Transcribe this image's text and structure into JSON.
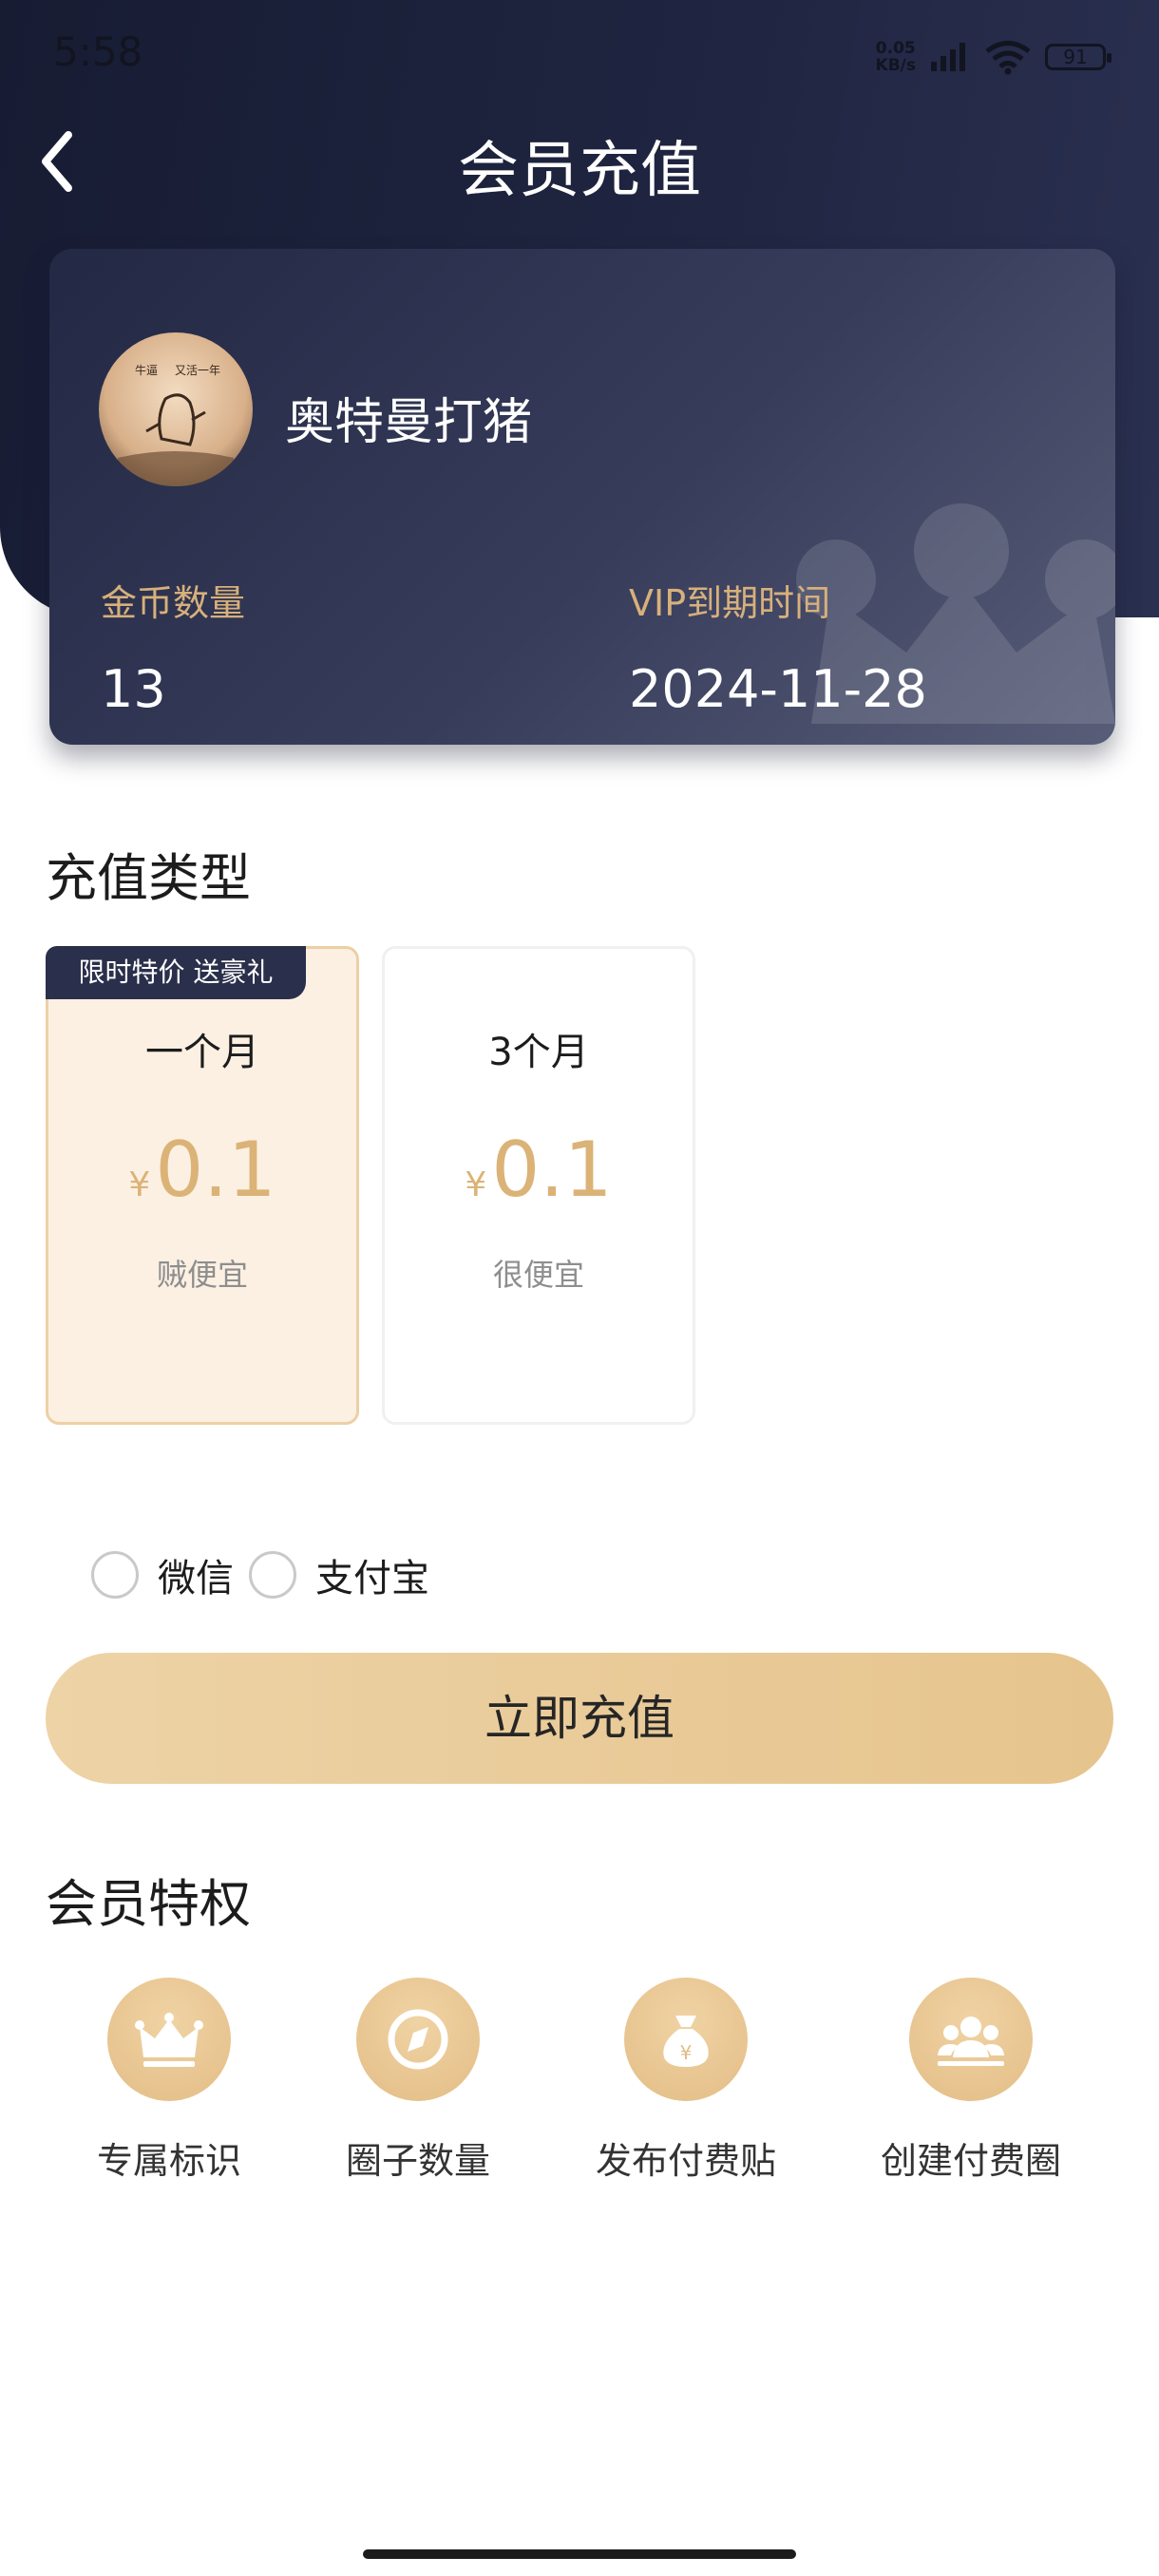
{
  "status_bar": {
    "time": "5:58",
    "net_speed_value": "0.05",
    "net_speed_unit": "KB/s",
    "battery": "91"
  },
  "header": {
    "title": "会员充值"
  },
  "member_card": {
    "username": "奥特曼打猪",
    "coins_label": "金币数量",
    "coins_value": "13",
    "vip_label": "VIP到期时间",
    "vip_value": "2024-11-28",
    "avatar_text_1": "牛逼",
    "avatar_text_2": "又活一年"
  },
  "recharge_type": {
    "title": "充值类型",
    "plans": [
      {
        "tag": "限时特价 送豪礼",
        "name": "一个月",
        "currency": "¥",
        "price": "0.1",
        "desc": "贼便宜",
        "selected": true
      },
      {
        "name": "3个月",
        "currency": "¥",
        "price": "0.1",
        "desc": "很便宜",
        "selected": false
      }
    ]
  },
  "payment": {
    "options": [
      "微信",
      "支付宝"
    ]
  },
  "recharge_button": "立即充值",
  "privileges": {
    "title": "会员特权",
    "items": [
      {
        "label": "专属标识",
        "icon": "crown-icon"
      },
      {
        "label": "圈子数量",
        "icon": "compass-icon"
      },
      {
        "label": "发布付费贴",
        "icon": "money-bag-icon"
      },
      {
        "label": "创建付费圈",
        "icon": "group-icon"
      }
    ]
  },
  "colors": {
    "accent_gold": "#dbb377",
    "header_dark": "#1f2540",
    "button_gold": "#e9ca96"
  }
}
